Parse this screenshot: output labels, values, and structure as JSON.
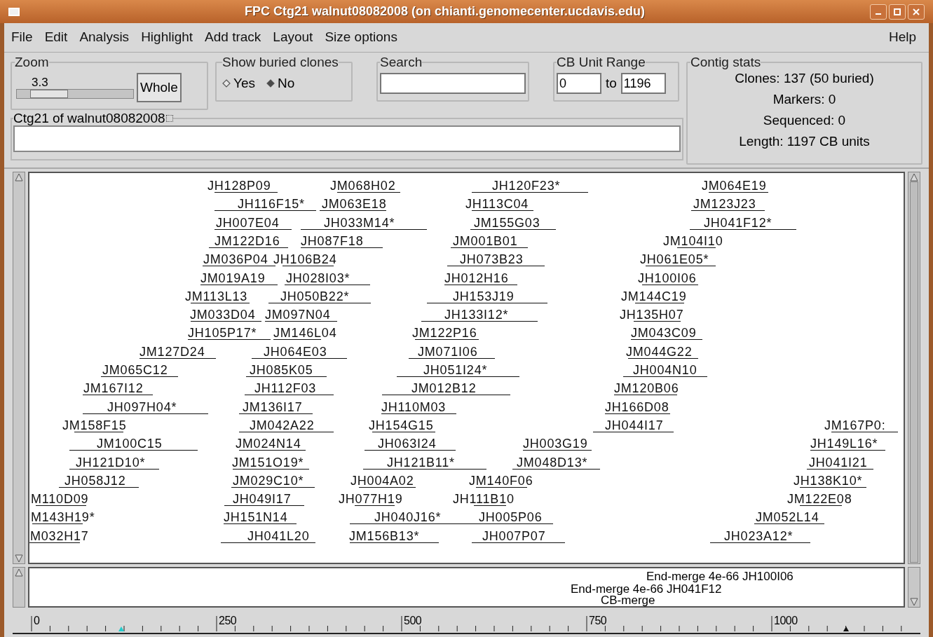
{
  "window": {
    "title": "FPC Ctg21 walnut08082008 (on chianti.genomecenter.ucdavis.edu)"
  },
  "menu": {
    "items": [
      "File",
      "Edit",
      "Analysis",
      "Highlight",
      "Add track",
      "Layout",
      "Size options"
    ],
    "help": "Help"
  },
  "zoom": {
    "label": "Zoom",
    "value": "3.3",
    "level": 0.17,
    "button": "Whole"
  },
  "buried": {
    "label": "Show buried clones",
    "options": [
      {
        "label": "Yes",
        "selected": false
      },
      {
        "label": "No",
        "selected": true
      }
    ]
  },
  "search": {
    "label": "Search"
  },
  "cb_range": {
    "label": "CB Unit Range",
    "from": "0",
    "to_label": "to",
    "to": "1196"
  },
  "contig": {
    "label": "Ctg21 of walnut08082008"
  },
  "stats": {
    "label": "Contig stats",
    "lines": [
      "Clones: 137 (50 buried)",
      "Markers: 0",
      "Sequenced: 0",
      "Length: 1197 CB units"
    ]
  },
  "clones": [
    {
      "name": "JH128P09"
    },
    {
      "name": "JM068H02"
    },
    {
      "name": "JH120F23*"
    },
    {
      "name": "JM064E19"
    },
    {
      "name": "JH116F15*"
    },
    {
      "name": "JM063E18"
    },
    {
      "name": "JH113C04"
    },
    {
      "name": "JM123J23"
    },
    {
      "name": "JH007E04"
    },
    {
      "name": "JH033M14*"
    },
    {
      "name": "JM155G03"
    },
    {
      "name": "JH041F12*"
    },
    {
      "name": "JM122D16"
    },
    {
      "name": "JH087F18"
    },
    {
      "name": "JM001B01"
    },
    {
      "name": "JM104I10"
    },
    {
      "name": "JM036P04"
    },
    {
      "name": "JH106B24"
    },
    {
      "name": "JH073B23"
    },
    {
      "name": "JH061E05*"
    },
    {
      "name": "JM019A19"
    },
    {
      "name": "JH028I03*"
    },
    {
      "name": "JH012H16"
    },
    {
      "name": "JH100I06"
    },
    {
      "name": "JM113L13"
    },
    {
      "name": "JH050B22*"
    },
    {
      "name": "JH153J19"
    },
    {
      "name": "JM144C19"
    },
    {
      "name": "JM033D04"
    },
    {
      "name": "JM097N04"
    },
    {
      "name": "JH133I12*"
    },
    {
      "name": "JH135H07"
    },
    {
      "name": "JH105P17*"
    },
    {
      "name": "JM146L04"
    },
    {
      "name": "JM122P16"
    },
    {
      "name": "JM043C09"
    },
    {
      "name": "JM127D24"
    },
    {
      "name": "JH064E03"
    },
    {
      "name": "JM071I06"
    },
    {
      "name": "JM044G22"
    },
    {
      "name": "JM065C12"
    },
    {
      "name": "JH085K05"
    },
    {
      "name": "JH051I24*"
    },
    {
      "name": "JH004N10"
    },
    {
      "name": "JM167I12"
    },
    {
      "name": "JH112F03"
    },
    {
      "name": "JM012B12"
    },
    {
      "name": "JM120B06"
    },
    {
      "name": "JH097H04*"
    },
    {
      "name": "JM136I17"
    },
    {
      "name": "JH110M03"
    },
    {
      "name": "JH166D08"
    },
    {
      "name": "JM158F15"
    },
    {
      "name": "JM042A22"
    },
    {
      "name": "JH154G15"
    },
    {
      "name": "JH044I17"
    },
    {
      "name": "JM167P0:"
    },
    {
      "name": "JM100C15"
    },
    {
      "name": "JM024N14"
    },
    {
      "name": "JH063I24"
    },
    {
      "name": "JH003G19"
    },
    {
      "name": "JH149L16*"
    },
    {
      "name": "JH121D10*"
    },
    {
      "name": "JM151O19*"
    },
    {
      "name": "JH121B11*"
    },
    {
      "name": "JM048D13*"
    },
    {
      "name": "JH041I21"
    },
    {
      "name": "JH058J12"
    },
    {
      "name": "JM029C10*"
    },
    {
      "name": "JH004A02"
    },
    {
      "name": "JM140F06"
    },
    {
      "name": "JH138K10*"
    },
    {
      "name": "M110D09"
    },
    {
      "name": "JH049I17"
    },
    {
      "name": "JH077H19"
    },
    {
      "name": "JH111B10"
    },
    {
      "name": "JM122E08"
    },
    {
      "name": "M143H19*"
    },
    {
      "name": "JH151N14"
    },
    {
      "name": "JH040J16*"
    },
    {
      "name": "JH005P06"
    },
    {
      "name": "JM052L14"
    },
    {
      "name": "M032H17"
    },
    {
      "name": "JH041L20"
    },
    {
      "name": "JM156B13*"
    },
    {
      "name": "JH007P07"
    },
    {
      "name": "JH023A12*"
    }
  ],
  "merges": [
    "End-merge 4e-66 JH100I06",
    "End-merge 4e-66 JH041F12",
    "CB-merge"
  ],
  "ruler": {
    "labels": [
      "0",
      "250",
      "500",
      "750",
      "1000"
    ]
  }
}
